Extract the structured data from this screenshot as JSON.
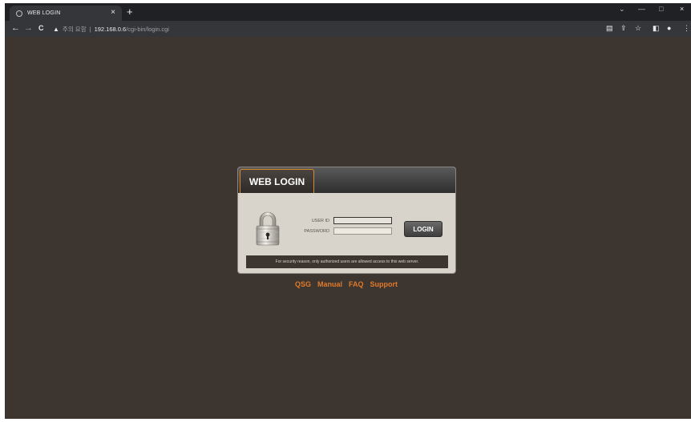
{
  "browser": {
    "tab_title": "WEB LOGIN",
    "tab_close": "×",
    "new_tab": "+",
    "address": {
      "security_label": "주의 요함",
      "separator": "|",
      "host": "192.168.0.6",
      "path": "/cgi-bin/login.cgi"
    },
    "nav": {
      "back": "←",
      "forward": "→",
      "reload": "C"
    },
    "window_controls": {
      "chevron": "⌄",
      "minimize": "—",
      "maximize": "□",
      "close": "×"
    },
    "toolbar_icons": [
      "translate-icon",
      "share-icon",
      "star-icon",
      "sidepanel-icon",
      "profile-icon",
      "menu-icon"
    ]
  },
  "login": {
    "header_title": "WEB LOGIN",
    "user_id_label": "USER ID",
    "password_label": "PASSWORD",
    "user_id_value": "",
    "password_value": "",
    "login_button": "LOGIN",
    "notice": "For security reason, only authorized users are allowed access to this web server."
  },
  "links": [
    "QSG",
    "Manual",
    "FAQ",
    "Support"
  ],
  "colors": {
    "page_bg": "#3d3530",
    "panel_bg": "#d8d3cb",
    "accent_orange": "#e07a2a",
    "tab_border": "#d88a2a"
  }
}
